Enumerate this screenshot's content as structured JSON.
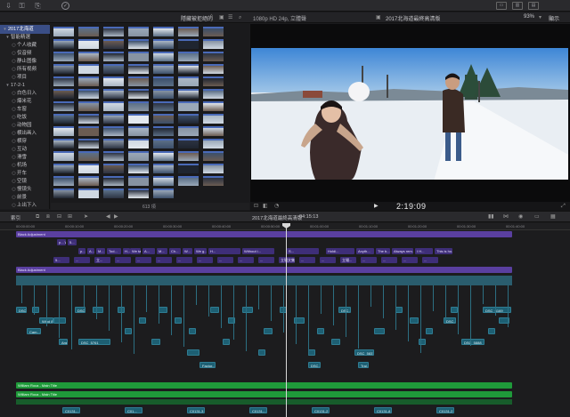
{
  "toolbar": {
    "left_icons": [
      "import-icon",
      "keyword-icon",
      "share-icon",
      "check-icon"
    ],
    "right_icons": [
      "layout-icon",
      "inspector-icon"
    ]
  },
  "browser_header": {
    "filter": "隱藏被拒絕的",
    "filter_chevron": "◊",
    "format": "1080p HD 24p, 立體聲",
    "project": "2017北海道最終高清版",
    "zoom": "93%",
    "display": "顯示"
  },
  "sidebar": {
    "items": [
      {
        "label": "2017北海道",
        "glyph": "▾",
        "selected": true
      },
      {
        "label": "智能精選",
        "glyph": "▾",
        "selected": false
      },
      {
        "label": "个人收藏",
        "glyph": "○",
        "selected": false
      },
      {
        "label": "仅音频",
        "glyph": "○",
        "selected": false
      },
      {
        "label": "静止图像",
        "glyph": "○",
        "selected": false
      },
      {
        "label": "所有视频",
        "glyph": "○",
        "selected": false
      },
      {
        "label": "项目",
        "glyph": "○",
        "selected": false
      },
      {
        "label": "17-2-1",
        "glyph": "▾",
        "selected": false
      },
      {
        "label": "白色日入",
        "glyph": "○",
        "selected": false
      },
      {
        "label": "爆米花",
        "glyph": "○",
        "selected": false
      },
      {
        "label": "车窗",
        "glyph": "○",
        "selected": false
      },
      {
        "label": "吃饭",
        "glyph": "○",
        "selected": false
      },
      {
        "label": "动物园",
        "glyph": "○",
        "selected": false
      },
      {
        "label": "横出画入",
        "glyph": "○",
        "selected": false
      },
      {
        "label": "横穿",
        "glyph": "○",
        "selected": false
      },
      {
        "label": "互动",
        "glyph": "○",
        "selected": false
      },
      {
        "label": "滑雪",
        "glyph": "○",
        "selected": false
      },
      {
        "label": "机场",
        "glyph": "○",
        "selected": false
      },
      {
        "label": "开车",
        "glyph": "○",
        "selected": false
      },
      {
        "label": "空镜",
        "glyph": "○",
        "selected": false
      },
      {
        "label": "慢镜头",
        "glyph": "○",
        "selected": false
      },
      {
        "label": "前景",
        "glyph": "○",
        "selected": false
      },
      {
        "label": "上出下入",
        "glyph": "○",
        "selected": false
      }
    ]
  },
  "browser": {
    "count": "613 項"
  },
  "viewer": {
    "timecode": "2:19:09"
  },
  "timeline_header": {
    "index": "索引",
    "title": "2017北海道最終高清版",
    "duration": "04:15:13"
  },
  "ruler": {
    "ticks": [
      "00:00:00:00",
      "00:00:10:00",
      "00:00:20:00",
      "00:00:30:00",
      "00:00:40:00",
      "00:00:50:00",
      "00:01:00:00",
      "00:01:10:00",
      "00:01:20:00",
      "00:01:30:00",
      "00:01:40:00"
    ]
  },
  "timeline": {
    "adjustment_label": "Black Adjustment",
    "adjustment_label_2": "Black Adjustment",
    "title_clip": "William Roca - Main Title",
    "title_clip_2": "William Roca - Main Title",
    "titles_row1": [
      "p... With...",
      "5...",
      "p...",
      "A...",
      "M...",
      "Tod...",
      "H...",
      "We tal...",
      "A...",
      "M...",
      "Ch...",
      "W...",
      "We g...",
      "H...",
      "Without i...",
      "S...",
      "Holdi...",
      "Anyth...",
      "The b...",
      "Always rem...",
      "I H...",
      "This is ho..."
    ],
    "titles_row2": [
      "5...",
      "...",
      "立...",
      "...",
      "...",
      "...",
      "...",
      "...",
      "...",
      "...",
      "...",
      "立場文集",
      "...",
      "...",
      "立場...",
      "...",
      "...",
      "...",
      "..."
    ],
    "clip_labels": [
      "DSC...",
      "DSC...",
      "Wind 8",
      "Cam...",
      "Arg...",
      "DSC_5761",
      "Factor...",
      "DSC...",
      "DSC_5837",
      "Trai...",
      "DSC_5888",
      "DSC_6169",
      "DSC...",
      "DSC..."
    ],
    "audio_labels": [
      "C0131-...",
      "C01...",
      "C0131-3",
      "C0131-...",
      "C0131-2",
      "C0131-8",
      "C0131-2"
    ]
  }
}
